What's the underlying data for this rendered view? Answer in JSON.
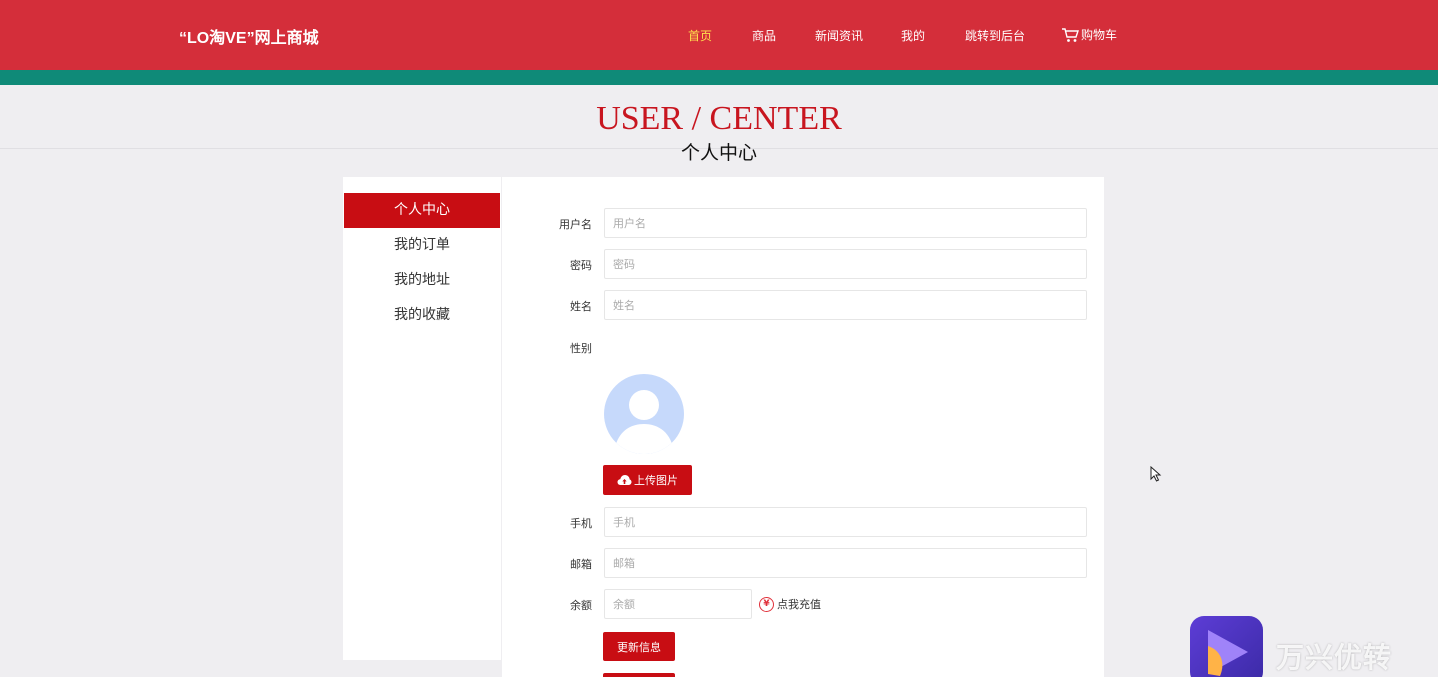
{
  "header": {
    "brand": "“LO淘VE”网上商城",
    "nav": [
      "首页",
      "商品",
      "新闻资讯",
      "我的",
      "跳转到后台"
    ],
    "cart_label": "购物车",
    "colors": {
      "bar": "#d42e3a",
      "stripe": "#0f8a78",
      "active_nav": "#ffe04d"
    }
  },
  "hero": {
    "title": "USER / CENTER",
    "subtitle": "个人中心"
  },
  "sidebar": {
    "items": [
      "个人中心",
      "我的订单",
      "我的地址",
      "我的收藏"
    ],
    "active": "个人中心"
  },
  "form": {
    "username": {
      "label": "用户名",
      "placeholder": "用户名"
    },
    "password": {
      "label": "密码",
      "placeholder": "密码"
    },
    "name": {
      "label": "姓名",
      "placeholder": "姓名"
    },
    "gender": {
      "label": "性别"
    },
    "upload_label": "上传图片",
    "phone": {
      "label": "手机",
      "placeholder": "手机"
    },
    "email": {
      "label": "邮箱",
      "placeholder": "邮箱"
    },
    "balance": {
      "label": "余额",
      "placeholder": "余额"
    },
    "recharge_label": "点我充值",
    "recharge_symbol": "¥",
    "update_label": "更新信息"
  },
  "watermark": {
    "text": "万兴优转"
  }
}
